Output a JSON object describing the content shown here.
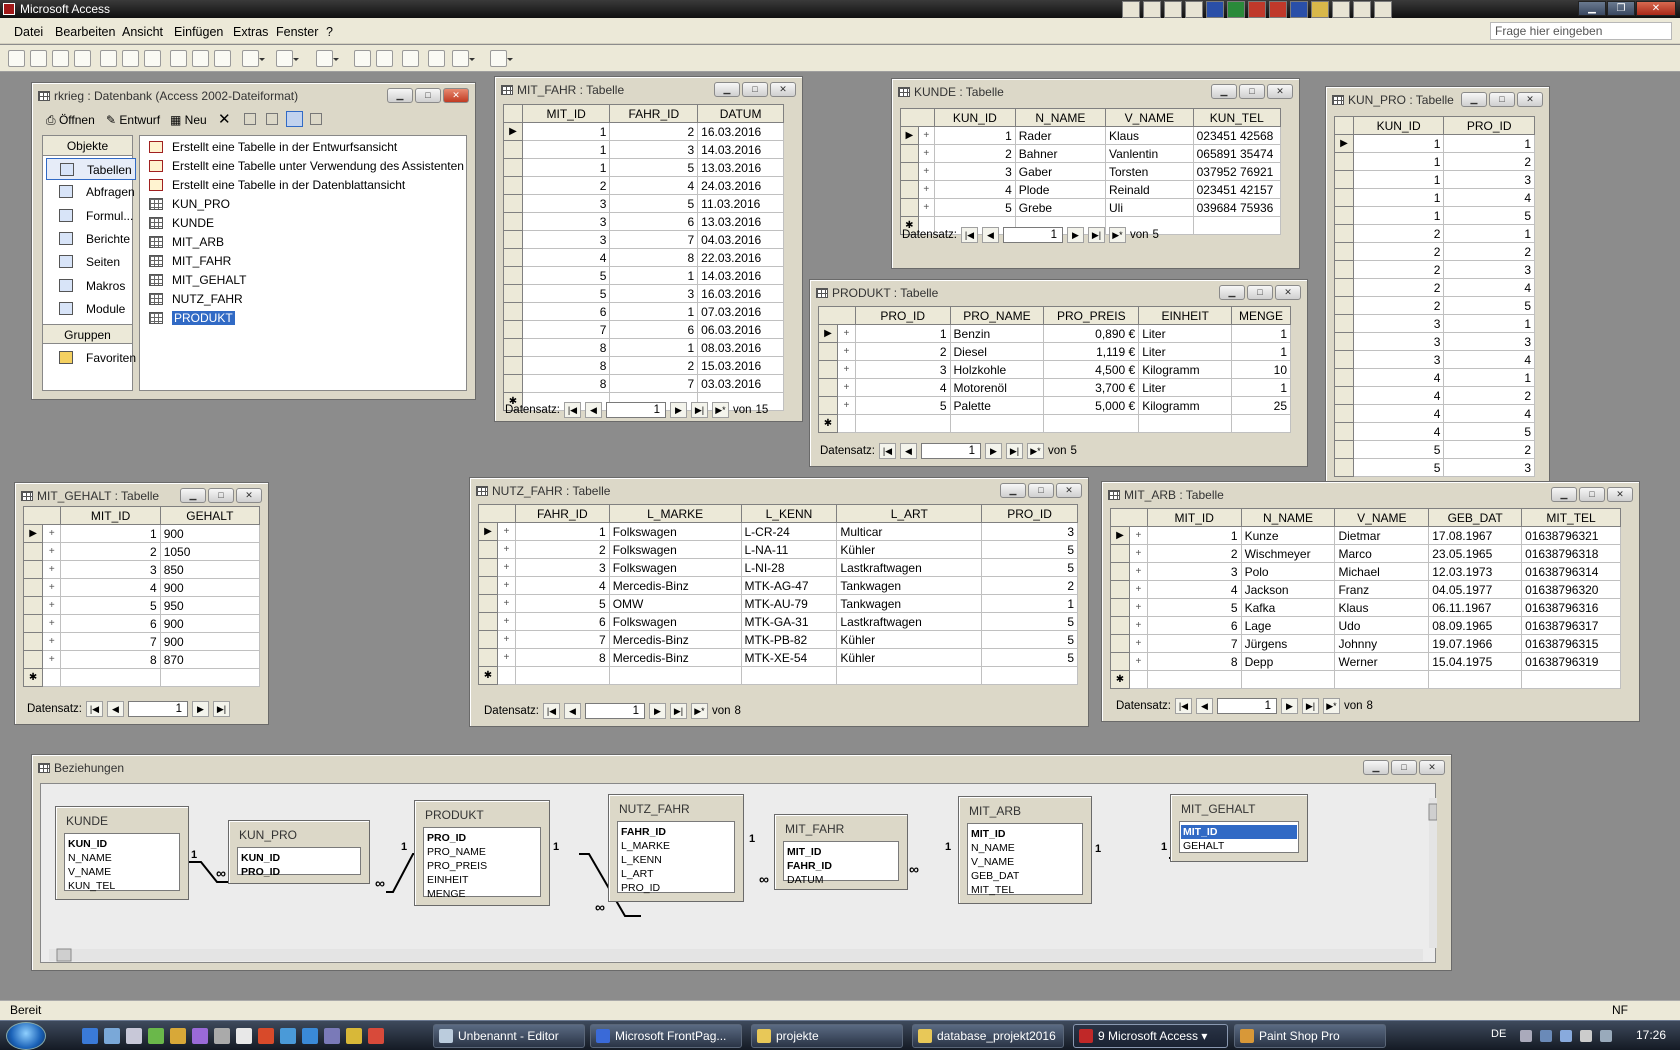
{
  "app": {
    "title": "Microsoft Access"
  },
  "menubar": {
    "items": [
      "Datei",
      "Bearbeiten",
      "Ansicht",
      "Einfügen",
      "Extras",
      "Fenster",
      "?"
    ],
    "ask_placeholder": "Frage hier eingeben"
  },
  "nav_labels": {
    "record": "Datensatz:",
    "of": "von"
  },
  "db_window": {
    "title": "rkrieg : Datenbank (Access 2002-Dateiformat)",
    "toolbar": {
      "open": "Öffnen",
      "design": "Entwurf",
      "new": "Neu"
    },
    "objects_header": "Objekte",
    "objects": [
      "Tabellen",
      "Abfragen",
      "Formul...",
      "Berichte",
      "Seiten",
      "Makros",
      "Module"
    ],
    "groups_header": "Gruppen",
    "groups": [
      "Favoriten"
    ],
    "items": [
      {
        "label": "Erstellt eine Tabelle in der Entwurfsansicht",
        "icon": "wizard-icon"
      },
      {
        "label": "Erstellt eine Tabelle unter Verwendung des Assistenten",
        "icon": "wizard-icon"
      },
      {
        "label": "Erstellt eine Tabelle in der Datenblattansicht",
        "icon": "wizard-icon"
      },
      {
        "label": "KUN_PRO",
        "icon": "table-icon"
      },
      {
        "label": "KUNDE",
        "icon": "table-icon"
      },
      {
        "label": "MIT_ARB",
        "icon": "table-icon"
      },
      {
        "label": "MIT_FAHR",
        "icon": "table-icon"
      },
      {
        "label": "MIT_GEHALT",
        "icon": "table-icon"
      },
      {
        "label": "NUTZ_FAHR",
        "icon": "table-icon"
      },
      {
        "label": "PRODUKT",
        "icon": "table-icon",
        "selected": true
      }
    ]
  },
  "mit_fahr": {
    "title": "MIT_FAHR : Tabelle",
    "columns": [
      "MIT_ID",
      "FAHR_ID",
      "DATUM"
    ],
    "rows": [
      [
        "1",
        "2",
        "16.03.2016"
      ],
      [
        "1",
        "3",
        "14.03.2016"
      ],
      [
        "1",
        "5",
        "13.03.2016"
      ],
      [
        "2",
        "4",
        "24.03.2016"
      ],
      [
        "3",
        "5",
        "11.03.2016"
      ],
      [
        "3",
        "6",
        "13.03.2016"
      ],
      [
        "3",
        "7",
        "04.03.2016"
      ],
      [
        "4",
        "8",
        "22.03.2016"
      ],
      [
        "5",
        "1",
        "14.03.2016"
      ],
      [
        "5",
        "3",
        "16.03.2016"
      ],
      [
        "6",
        "1",
        "07.03.2016"
      ],
      [
        "7",
        "6",
        "06.03.2016"
      ],
      [
        "8",
        "1",
        "08.03.2016"
      ],
      [
        "8",
        "2",
        "15.03.2016"
      ],
      [
        "8",
        "7",
        "03.03.2016"
      ]
    ],
    "record": "1",
    "total": "15"
  },
  "kunde": {
    "title": "KUNDE : Tabelle",
    "columns": [
      "KUN_ID",
      "N_NAME",
      "V_NAME",
      "KUN_TEL"
    ],
    "rows": [
      [
        "1",
        "Rader",
        "Klaus",
        "023451 42568"
      ],
      [
        "2",
        "Bahner",
        "Vanlentin",
        "065891 35474"
      ],
      [
        "3",
        "Gaber",
        "Torsten",
        "037952 76921"
      ],
      [
        "4",
        "Plode",
        "Reinald",
        "023451 42157"
      ],
      [
        "5",
        "Grebe",
        "Uli",
        "039684 75936"
      ]
    ],
    "record": "1",
    "total": "5"
  },
  "kun_pro": {
    "title": "KUN_PRO : Tabelle",
    "columns": [
      "KUN_ID",
      "PRO_ID"
    ],
    "rows": [
      [
        "1",
        "1"
      ],
      [
        "1",
        "2"
      ],
      [
        "1",
        "3"
      ],
      [
        "1",
        "4"
      ],
      [
        "1",
        "5"
      ],
      [
        "2",
        "1"
      ],
      [
        "2",
        "2"
      ],
      [
        "2",
        "3"
      ],
      [
        "2",
        "4"
      ],
      [
        "2",
        "5"
      ],
      [
        "3",
        "1"
      ],
      [
        "3",
        "3"
      ],
      [
        "3",
        "4"
      ],
      [
        "4",
        "1"
      ],
      [
        "4",
        "2"
      ],
      [
        "4",
        "4"
      ],
      [
        "4",
        "5"
      ],
      [
        "5",
        "2"
      ],
      [
        "5",
        "3"
      ]
    ]
  },
  "produkt": {
    "title": "PRODUKT : Tabelle",
    "columns": [
      "PRO_ID",
      "PRO_NAME",
      "PRO_PREIS",
      "EINHEIT",
      "MENGE"
    ],
    "rows": [
      [
        "1",
        "Benzin",
        "0,890 €",
        "Liter",
        "1"
      ],
      [
        "2",
        "Diesel",
        "1,119 €",
        "Liter",
        "1"
      ],
      [
        "3",
        "Holzkohle",
        "4,500 €",
        "Kilogramm",
        "10"
      ],
      [
        "4",
        "Motorenöl",
        "3,700 €",
        "Liter",
        "1"
      ],
      [
        "5",
        "Palette",
        "5,000 €",
        "Kilogramm",
        "25"
      ]
    ],
    "record": "1",
    "total": "5"
  },
  "mit_gehalt": {
    "title": "MIT_GEHALT : Tabelle",
    "columns": [
      "MIT_ID",
      "GEHALT"
    ],
    "rows": [
      [
        "1",
        "900"
      ],
      [
        "2",
        "1050"
      ],
      [
        "3",
        "850"
      ],
      [
        "4",
        "900"
      ],
      [
        "5",
        "950"
      ],
      [
        "6",
        "900"
      ],
      [
        "7",
        "900"
      ],
      [
        "8",
        "870"
      ]
    ],
    "record": "1"
  },
  "nutz_fahr": {
    "title": "NUTZ_FAHR : Tabelle",
    "columns": [
      "FAHR_ID",
      "L_MARKE",
      "L_KENN",
      "L_ART",
      "PRO_ID"
    ],
    "rows": [
      [
        "1",
        "Folkswagen",
        "L-CR-24",
        "Multicar",
        "3"
      ],
      [
        "2",
        "Folkswagen",
        "L-NA-11",
        "Kühler",
        "5"
      ],
      [
        "3",
        "Folkswagen",
        "L-NI-28",
        "Lastkraftwagen",
        "5"
      ],
      [
        "4",
        "Mercedis-Binz",
        "MTK-AG-47",
        "Tankwagen",
        "2"
      ],
      [
        "5",
        "OMW",
        "MTK-AU-79",
        "Tankwagen",
        "1"
      ],
      [
        "6",
        "Folkswagen",
        "MTK-GA-31",
        "Lastkraftwagen",
        "5"
      ],
      [
        "7",
        "Mercedis-Binz",
        "MTK-PB-82",
        "Kühler",
        "5"
      ],
      [
        "8",
        "Mercedis-Binz",
        "MTK-XE-54",
        "Kühler",
        "5"
      ]
    ],
    "record": "1",
    "total": "8"
  },
  "mit_arb": {
    "title": "MIT_ARB : Tabelle",
    "columns": [
      "MIT_ID",
      "N_NAME",
      "V_NAME",
      "GEB_DAT",
      "MIT_TEL"
    ],
    "rows": [
      [
        "1",
        "Kunze",
        "Dietmar",
        "17.08.1967",
        "01638796321"
      ],
      [
        "2",
        "Wischmeyer",
        "Marco",
        "23.05.1965",
        "01638796318"
      ],
      [
        "3",
        "Polo",
        "Michael",
        "12.03.1973",
        "01638796314"
      ],
      [
        "4",
        "Jackson",
        "Franz",
        "04.05.1977",
        "01638796320"
      ],
      [
        "5",
        "Kafka",
        "Klaus",
        "06.11.1967",
        "01638796316"
      ],
      [
        "6",
        "Lage",
        "Udo",
        "08.09.1965",
        "01638796317"
      ],
      [
        "7",
        "Jürgens",
        "Johnny",
        "19.07.1966",
        "01638796315"
      ],
      [
        "8",
        "Depp",
        "Werner",
        "15.04.1975",
        "01638796319"
      ]
    ],
    "record": "1",
    "total": "8"
  },
  "relations": {
    "title": "Beziehungen",
    "tables": [
      {
        "name": "KUNDE",
        "fields": [
          {
            "n": "KUN_ID",
            "pk": true
          },
          {
            "n": "N_NAME"
          },
          {
            "n": "V_NAME"
          },
          {
            "n": "KUN_TEL"
          }
        ]
      },
      {
        "name": "KUN_PRO",
        "fields": [
          {
            "n": "KUN_ID",
            "pk": true
          },
          {
            "n": "PRO_ID",
            "pk": true
          }
        ]
      },
      {
        "name": "PRODUKT",
        "fields": [
          {
            "n": "PRO_ID",
            "pk": true
          },
          {
            "n": "PRO_NAME"
          },
          {
            "n": "PRO_PREIS"
          },
          {
            "n": "EINHEIT"
          },
          {
            "n": "MENGE"
          }
        ]
      },
      {
        "name": "NUTZ_FAHR",
        "fields": [
          {
            "n": "FAHR_ID",
            "pk": true
          },
          {
            "n": "L_MARKE"
          },
          {
            "n": "L_KENN"
          },
          {
            "n": "L_ART"
          },
          {
            "n": "PRO_ID"
          }
        ]
      },
      {
        "name": "MIT_FAHR",
        "fields": [
          {
            "n": "MIT_ID",
            "pk": true
          },
          {
            "n": "FAHR_ID",
            "pk": true
          },
          {
            "n": "DATUM"
          }
        ]
      },
      {
        "name": "MIT_ARB",
        "fields": [
          {
            "n": "MIT_ID",
            "pk": true
          },
          {
            "n": "N_NAME"
          },
          {
            "n": "V_NAME"
          },
          {
            "n": "GEB_DAT"
          },
          {
            "n": "MIT_TEL"
          }
        ]
      },
      {
        "name": "MIT_GEHALT",
        "fields": [
          {
            "n": "MIT_ID",
            "pk": true,
            "hl": true
          },
          {
            "n": "GEHALT"
          }
        ]
      }
    ],
    "card_one": "1",
    "card_many": "∞"
  },
  "statusbar": {
    "left": "Bereit",
    "right": "NF"
  },
  "taskbar": {
    "tasks": [
      "Unbenannt - Editor",
      "Microsoft FrontPag...",
      "projekte",
      "database_projekt2016",
      "9 Microsoft Access",
      "Paint Shop Pro"
    ],
    "lang": "DE",
    "clock": "17:26"
  },
  "colors": {
    "selection": "#316ac5",
    "window_bg": "#dcd8c8",
    "workspace": "#8c8c8c"
  }
}
